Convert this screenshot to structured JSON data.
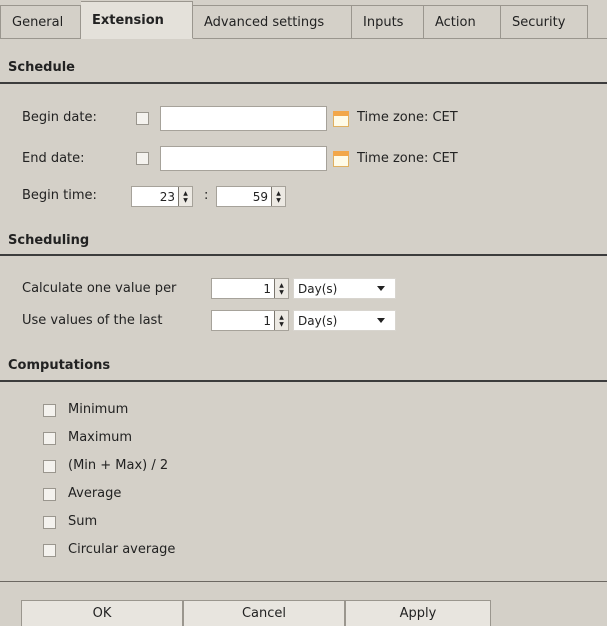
{
  "tabs": [
    "General",
    "Extension",
    "Advanced settings",
    "Inputs",
    "Action",
    "Security"
  ],
  "active_tab": "Extension",
  "schedule": {
    "title": "Schedule",
    "begin_date_label": "Begin date:",
    "end_date_label": "End date:",
    "begin_date_value": "",
    "end_date_value": "",
    "timezone_begin": "Time zone: CET",
    "timezone_end": "Time zone: CET",
    "begin_time_label": "Begin time:",
    "hour": "23",
    "minute": "59",
    "separator": ":"
  },
  "scheduling": {
    "title": "Scheduling",
    "calc_label": "Calculate one value per",
    "calc_value": "1",
    "calc_unit": "Day(s)",
    "use_label": "Use values of the last",
    "use_value": "1",
    "use_unit": "Day(s)"
  },
  "computations": {
    "title": "Computations",
    "items": [
      "Minimum",
      "Maximum",
      "(Min + Max) / 2",
      "Average",
      "Sum",
      "Circular average"
    ]
  },
  "buttons": {
    "ok": "OK",
    "cancel": "Cancel",
    "apply": "Apply"
  },
  "icons": {
    "calendar": "calendar-icon",
    "spin": "spinner-arrows-icon",
    "dropdown": "chevron-down-icon"
  }
}
